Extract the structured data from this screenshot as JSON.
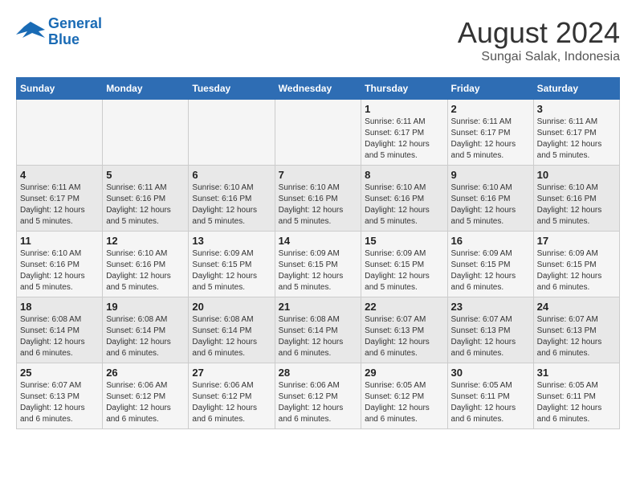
{
  "header": {
    "logo_line1": "General",
    "logo_line2": "Blue",
    "main_title": "August 2024",
    "subtitle": "Sungai Salak, Indonesia"
  },
  "calendar": {
    "days_of_week": [
      "Sunday",
      "Monday",
      "Tuesday",
      "Wednesday",
      "Thursday",
      "Friday",
      "Saturday"
    ],
    "weeks": [
      [
        {
          "day": "",
          "info": ""
        },
        {
          "day": "",
          "info": ""
        },
        {
          "day": "",
          "info": ""
        },
        {
          "day": "",
          "info": ""
        },
        {
          "day": "1",
          "info": "Sunrise: 6:11 AM\nSunset: 6:17 PM\nDaylight: 12 hours\nand 5 minutes."
        },
        {
          "day": "2",
          "info": "Sunrise: 6:11 AM\nSunset: 6:17 PM\nDaylight: 12 hours\nand 5 minutes."
        },
        {
          "day": "3",
          "info": "Sunrise: 6:11 AM\nSunset: 6:17 PM\nDaylight: 12 hours\nand 5 minutes."
        }
      ],
      [
        {
          "day": "4",
          "info": "Sunrise: 6:11 AM\nSunset: 6:17 PM\nDaylight: 12 hours\nand 5 minutes."
        },
        {
          "day": "5",
          "info": "Sunrise: 6:11 AM\nSunset: 6:16 PM\nDaylight: 12 hours\nand 5 minutes."
        },
        {
          "day": "6",
          "info": "Sunrise: 6:10 AM\nSunset: 6:16 PM\nDaylight: 12 hours\nand 5 minutes."
        },
        {
          "day": "7",
          "info": "Sunrise: 6:10 AM\nSunset: 6:16 PM\nDaylight: 12 hours\nand 5 minutes."
        },
        {
          "day": "8",
          "info": "Sunrise: 6:10 AM\nSunset: 6:16 PM\nDaylight: 12 hours\nand 5 minutes."
        },
        {
          "day": "9",
          "info": "Sunrise: 6:10 AM\nSunset: 6:16 PM\nDaylight: 12 hours\nand 5 minutes."
        },
        {
          "day": "10",
          "info": "Sunrise: 6:10 AM\nSunset: 6:16 PM\nDaylight: 12 hours\nand 5 minutes."
        }
      ],
      [
        {
          "day": "11",
          "info": "Sunrise: 6:10 AM\nSunset: 6:16 PM\nDaylight: 12 hours\nand 5 minutes."
        },
        {
          "day": "12",
          "info": "Sunrise: 6:10 AM\nSunset: 6:16 PM\nDaylight: 12 hours\nand 5 minutes."
        },
        {
          "day": "13",
          "info": "Sunrise: 6:09 AM\nSunset: 6:15 PM\nDaylight: 12 hours\nand 5 minutes."
        },
        {
          "day": "14",
          "info": "Sunrise: 6:09 AM\nSunset: 6:15 PM\nDaylight: 12 hours\nand 5 minutes."
        },
        {
          "day": "15",
          "info": "Sunrise: 6:09 AM\nSunset: 6:15 PM\nDaylight: 12 hours\nand 5 minutes."
        },
        {
          "day": "16",
          "info": "Sunrise: 6:09 AM\nSunset: 6:15 PM\nDaylight: 12 hours\nand 6 minutes."
        },
        {
          "day": "17",
          "info": "Sunrise: 6:09 AM\nSunset: 6:15 PM\nDaylight: 12 hours\nand 6 minutes."
        }
      ],
      [
        {
          "day": "18",
          "info": "Sunrise: 6:08 AM\nSunset: 6:14 PM\nDaylight: 12 hours\nand 6 minutes."
        },
        {
          "day": "19",
          "info": "Sunrise: 6:08 AM\nSunset: 6:14 PM\nDaylight: 12 hours\nand 6 minutes."
        },
        {
          "day": "20",
          "info": "Sunrise: 6:08 AM\nSunset: 6:14 PM\nDaylight: 12 hours\nand 6 minutes."
        },
        {
          "day": "21",
          "info": "Sunrise: 6:08 AM\nSunset: 6:14 PM\nDaylight: 12 hours\nand 6 minutes."
        },
        {
          "day": "22",
          "info": "Sunrise: 6:07 AM\nSunset: 6:13 PM\nDaylight: 12 hours\nand 6 minutes."
        },
        {
          "day": "23",
          "info": "Sunrise: 6:07 AM\nSunset: 6:13 PM\nDaylight: 12 hours\nand 6 minutes."
        },
        {
          "day": "24",
          "info": "Sunrise: 6:07 AM\nSunset: 6:13 PM\nDaylight: 12 hours\nand 6 minutes."
        }
      ],
      [
        {
          "day": "25",
          "info": "Sunrise: 6:07 AM\nSunset: 6:13 PM\nDaylight: 12 hours\nand 6 minutes."
        },
        {
          "day": "26",
          "info": "Sunrise: 6:06 AM\nSunset: 6:12 PM\nDaylight: 12 hours\nand 6 minutes."
        },
        {
          "day": "27",
          "info": "Sunrise: 6:06 AM\nSunset: 6:12 PM\nDaylight: 12 hours\nand 6 minutes."
        },
        {
          "day": "28",
          "info": "Sunrise: 6:06 AM\nSunset: 6:12 PM\nDaylight: 12 hours\nand 6 minutes."
        },
        {
          "day": "29",
          "info": "Sunrise: 6:05 AM\nSunset: 6:12 PM\nDaylight: 12 hours\nand 6 minutes."
        },
        {
          "day": "30",
          "info": "Sunrise: 6:05 AM\nSunset: 6:11 PM\nDaylight: 12 hours\nand 6 minutes."
        },
        {
          "day": "31",
          "info": "Sunrise: 6:05 AM\nSunset: 6:11 PM\nDaylight: 12 hours\nand 6 minutes."
        }
      ]
    ]
  }
}
